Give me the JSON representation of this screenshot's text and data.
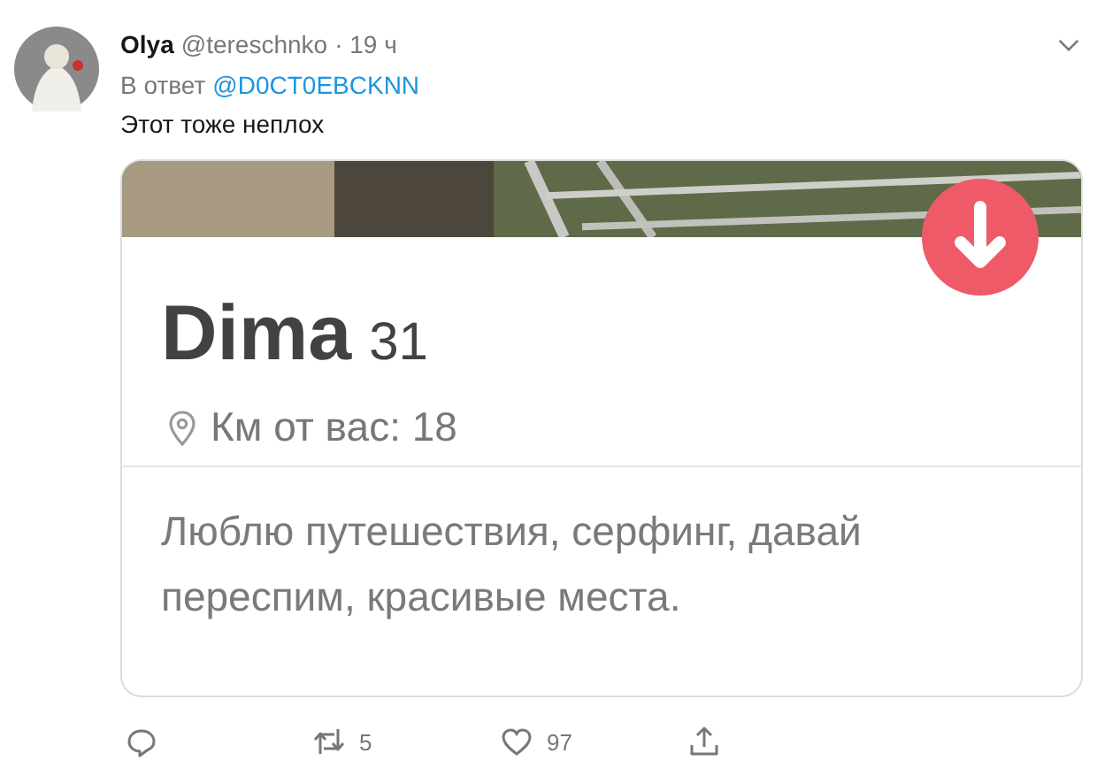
{
  "tweet": {
    "name": "Olya",
    "handle": "@tereschnko",
    "time": "· 19 ч",
    "reply_prefix": "В ответ",
    "reply_to": "@D0CT0EBCKNN",
    "text": "Этот тоже неплох"
  },
  "card": {
    "name": "Dima",
    "age": "31",
    "distance": "Км от вас: 18",
    "bio": "Люблю путешествия, серфинг, давай переспим, красивые места."
  },
  "actions": [
    {
      "kind": "reply"
    },
    {
      "kind": "retweet",
      "count": "5"
    },
    {
      "kind": "like",
      "count": "97"
    },
    {
      "kind": "share"
    }
  ]
}
